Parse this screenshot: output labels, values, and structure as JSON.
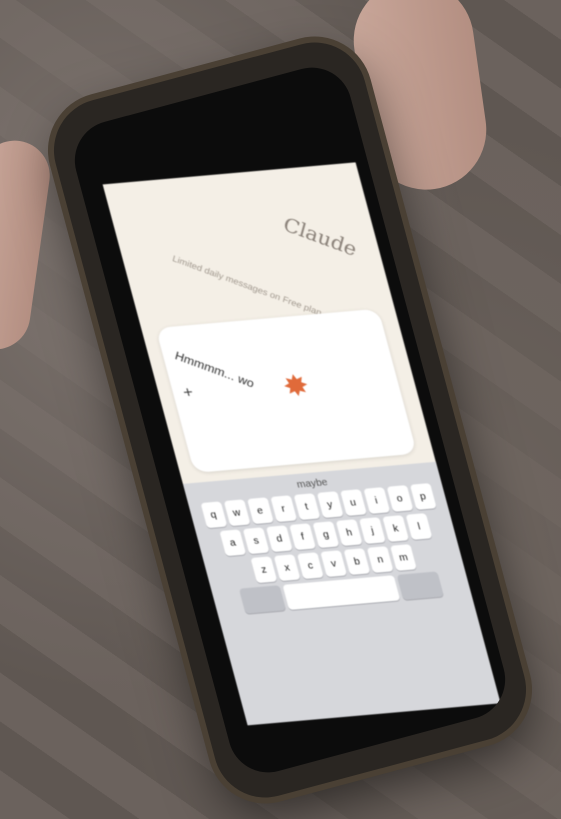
{
  "app": {
    "title": "Claude",
    "limit_note": "Limited daily messages on Free plan"
  },
  "input": {
    "typed_text": "Hmmmm... wo"
  },
  "icons": {
    "plus": "+",
    "spark": "✸",
    "send": "↑"
  },
  "keyboard": {
    "suggestion": "maybe",
    "rows": [
      [
        "q",
        "w",
        "e",
        "r",
        "t",
        "y",
        "u",
        "i",
        "o",
        "p"
      ],
      [
        "a",
        "s",
        "d",
        "f",
        "g",
        "h",
        "j",
        "k",
        "l"
      ],
      [
        "z",
        "x",
        "c",
        "v",
        "b",
        "n",
        "m"
      ]
    ]
  },
  "colors": {
    "accent": "#e07a50",
    "app_bg": "#f4efe6"
  }
}
